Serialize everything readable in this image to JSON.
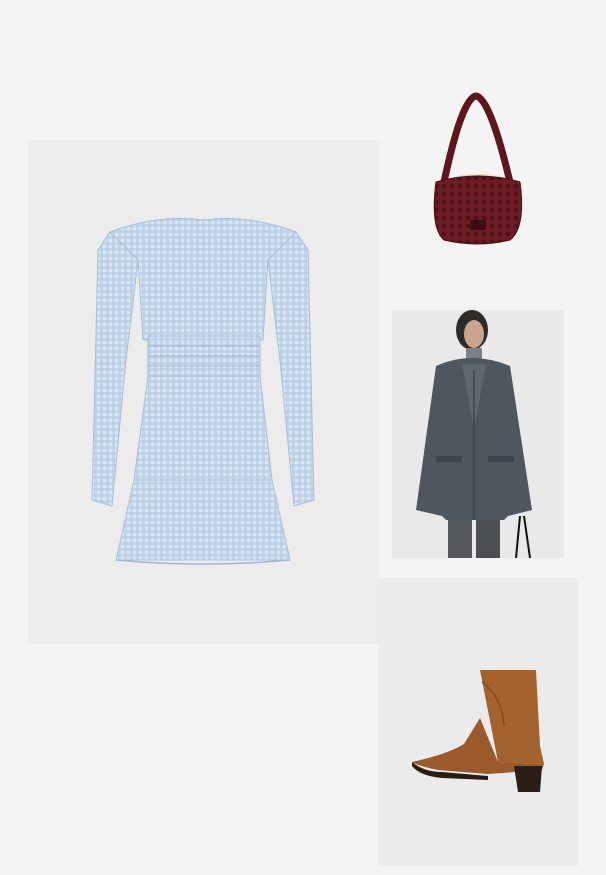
{
  "outfit": {
    "items": [
      {
        "id": "dress",
        "image_alt": "Light blue gingham long-sleeve smocked mini dress",
        "bg_color": "#ececec",
        "color": "#b8cde6"
      },
      {
        "id": "bag",
        "image_alt": "Burgundy woven crochet shoulder bag",
        "bg_color": "#f4f4f4",
        "color": "#6e1c24"
      },
      {
        "id": "blazer",
        "image_alt": "Model wearing a grey brushed wool blazer",
        "bg_color": "#e9e9e9",
        "color": "#4e5660"
      },
      {
        "id": "boot",
        "image_alt": "Tan suede pointed western ankle boot",
        "bg_color": "#ebebeb",
        "color": "#a3622e"
      }
    ]
  }
}
